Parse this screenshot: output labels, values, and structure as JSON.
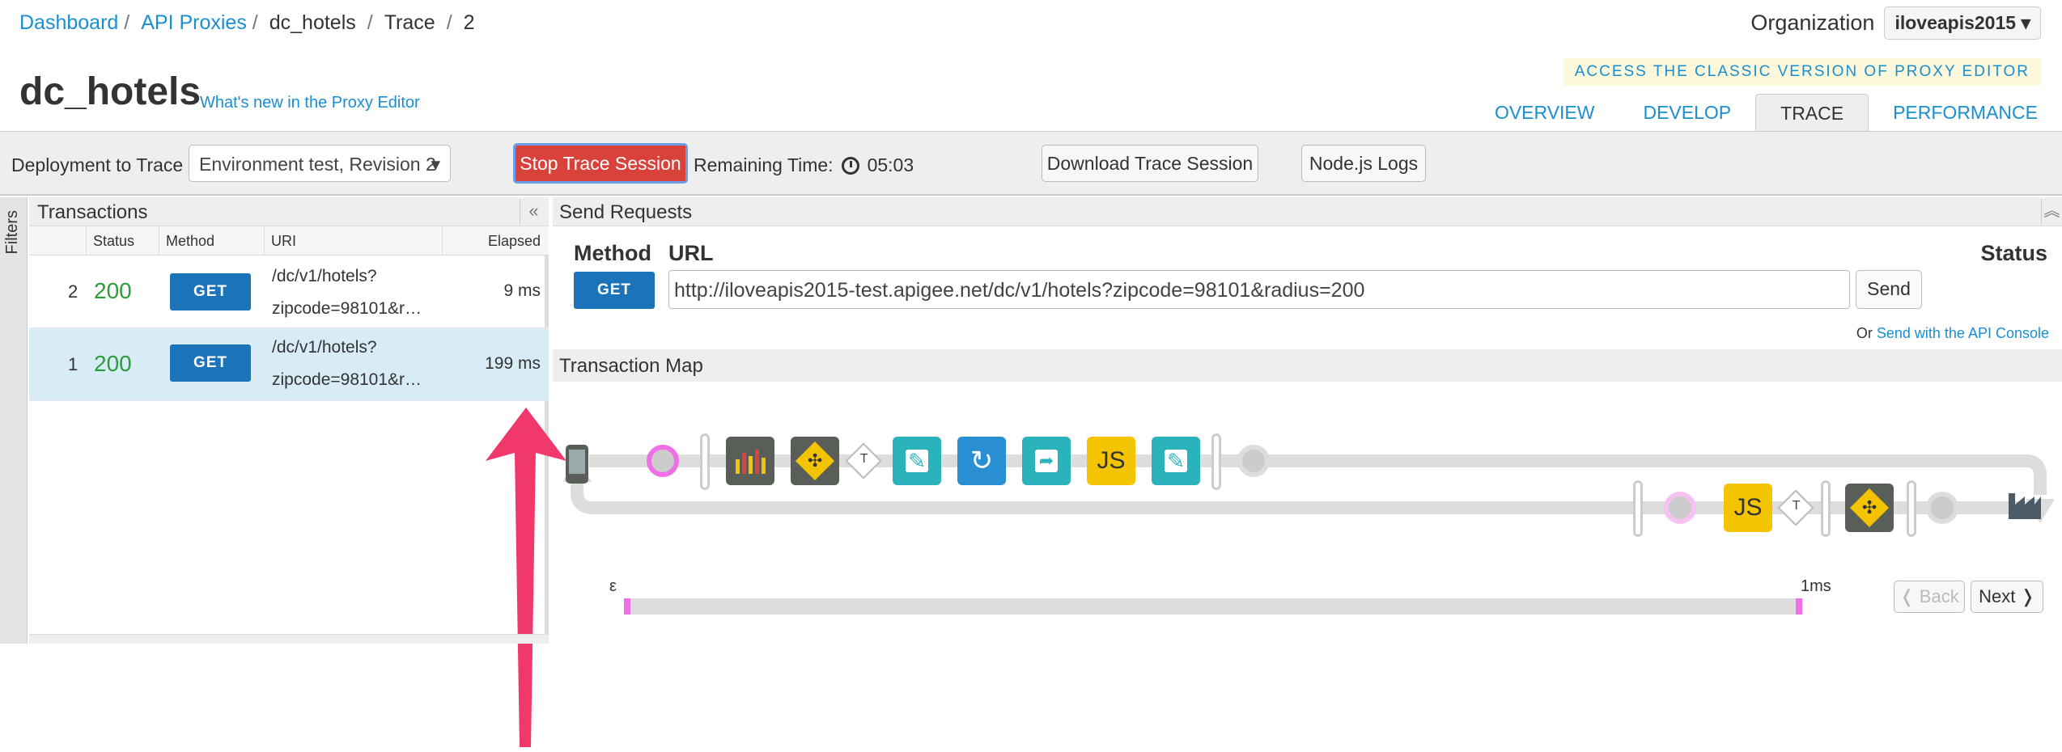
{
  "breadcrumb": {
    "dashboard": "Dashboard",
    "api_proxies": "API Proxies",
    "proxy": "dc_hotels",
    "trace": "Trace",
    "revision": "2",
    "separator": "/"
  },
  "organization": {
    "label": "Organization",
    "value": "iloveapis2015"
  },
  "classic_link": "ACCESS THE CLASSIC VERSION OF PROXY EDITOR",
  "page": {
    "title": "dc_hotels",
    "whats_new": "What's new in the Proxy Editor"
  },
  "tabs": [
    {
      "label": "OVERVIEW",
      "active": false
    },
    {
      "label": "DEVELOP",
      "active": false
    },
    {
      "label": "TRACE",
      "active": true
    },
    {
      "label": "PERFORMANCE",
      "active": false
    }
  ],
  "toolbar": {
    "deployment_label": "Deployment to Trace",
    "deployment_value": "Environment test, Revision 2",
    "stop_label": "Stop Trace Session",
    "remaining_label": "Remaining Time:",
    "remaining_value": "05:03",
    "download_label": "Download Trace Session",
    "node_logs_label": "Node.js Logs"
  },
  "filters_label": "Filters",
  "transactions": {
    "title": "Transactions",
    "collapse_icon": "«",
    "columns": [
      "Status",
      "Method",
      "URI",
      "Elapsed"
    ],
    "rows": [
      {
        "num": "2",
        "status": "200",
        "method": "GET",
        "uri_line1": "/dc/v1/hotels?",
        "uri_line2": "zipcode=98101&r…",
        "elapsed": "9 ms",
        "selected": false
      },
      {
        "num": "1",
        "status": "200",
        "method": "GET",
        "uri_line1": "/dc/v1/hotels?",
        "uri_line2": "zipcode=98101&r…",
        "elapsed": "199 ms",
        "selected": true
      }
    ]
  },
  "send_requests": {
    "title": "Send Requests",
    "method_label": "Method",
    "url_label": "URL",
    "status_label": "Status",
    "method_value": "GET",
    "url_value": "http://iloveapis2015-test.apigee.net/dc/v1/hotels?zipcode=98101&radius=200",
    "send_label": "Send",
    "or_text": "Or",
    "api_console_link": "Send with the API Console"
  },
  "transaction_map": {
    "title": "Transaction Map",
    "tiles_top": [
      "phone-icon",
      "statistics-icon",
      "flow-callout-icon",
      "assign-message-icon",
      "response-cache-icon",
      "extract-variables-icon",
      "javascript-icon",
      "assign-message-icon"
    ],
    "tiles_bottom": [
      "javascript-icon",
      "flow-callout-icon",
      "target-server-icon"
    ],
    "js_label": "JS",
    "t_label": "T",
    "colors": {
      "teal": "#2bb3bd",
      "blue": "#2a8ed3",
      "gray": "#5a5e58",
      "yellow": "#f5c400",
      "pink": "#ef6fe6",
      "arrow": "#dddddd",
      "annotation_arrow": "#f0386b"
    }
  },
  "timeline": {
    "start_label": "ε",
    "end_label": "1ms"
  },
  "pager": {
    "back_label": "❬ Back",
    "next_label": "Next ❭"
  }
}
